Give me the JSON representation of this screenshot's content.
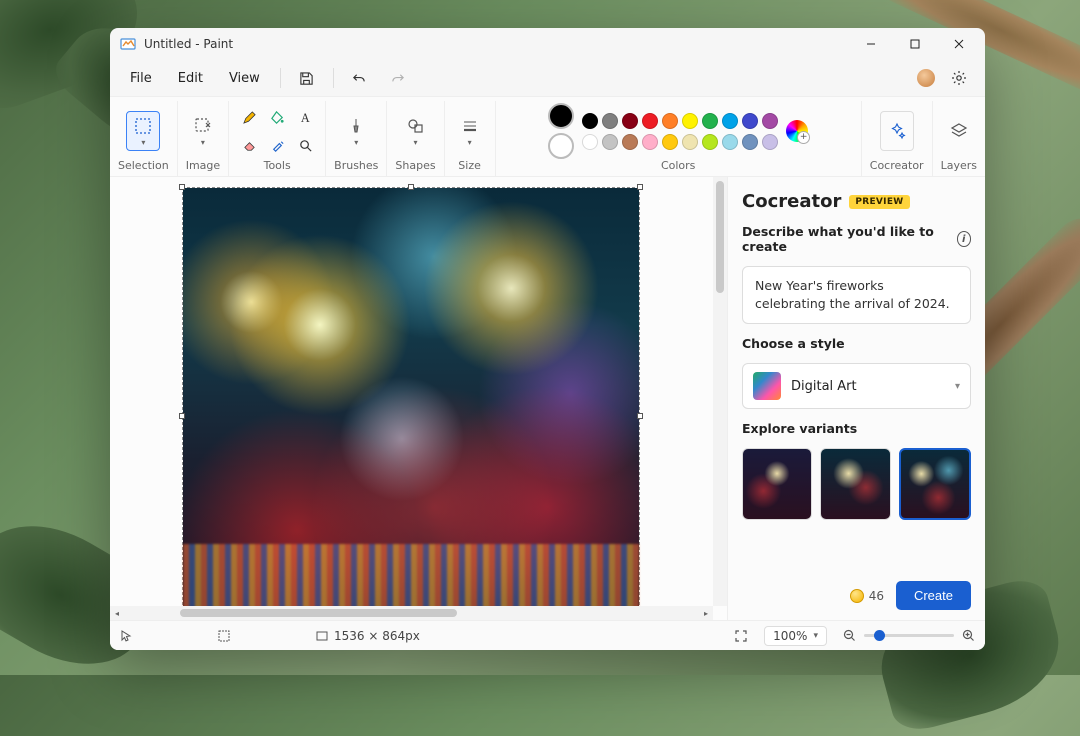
{
  "window": {
    "title": "Untitled - Paint"
  },
  "menubar": {
    "file": "File",
    "edit": "Edit",
    "view": "View"
  },
  "ribbon": {
    "selection": "Selection",
    "image": "Image",
    "tools": "Tools",
    "brushes": "Brushes",
    "shapes": "Shapes",
    "size": "Size",
    "colors": "Colors",
    "cocreator": "Cocreator",
    "layers": "Layers"
  },
  "color_row1": [
    "#000000",
    "#7f7f7f",
    "#880015",
    "#ed1c24",
    "#ff7f27",
    "#fff200",
    "#22b14c",
    "#00a2e8",
    "#3f48cc",
    "#a349a4"
  ],
  "color_row2": [
    "#ffffff",
    "#c3c3c3",
    "#b97a57",
    "#ffaec9",
    "#ffc90e",
    "#efe4b0",
    "#b5e61d",
    "#99d9ea",
    "#7092be",
    "#c8bfe7"
  ],
  "active_color1": "#000000",
  "active_color2": "#ffffff",
  "cocreator": {
    "title": "Cocreator",
    "badge": "PREVIEW",
    "describe_label": "Describe what you'd like to create",
    "prompt": "New Year's fireworks celebrating the arrival of 2024.",
    "style_label": "Choose a style",
    "style_value": "Digital Art",
    "variants_label": "Explore variants",
    "credits": "46",
    "create_button": "Create"
  },
  "status": {
    "dimensions": "1536 × 864px",
    "zoom": "100%"
  }
}
